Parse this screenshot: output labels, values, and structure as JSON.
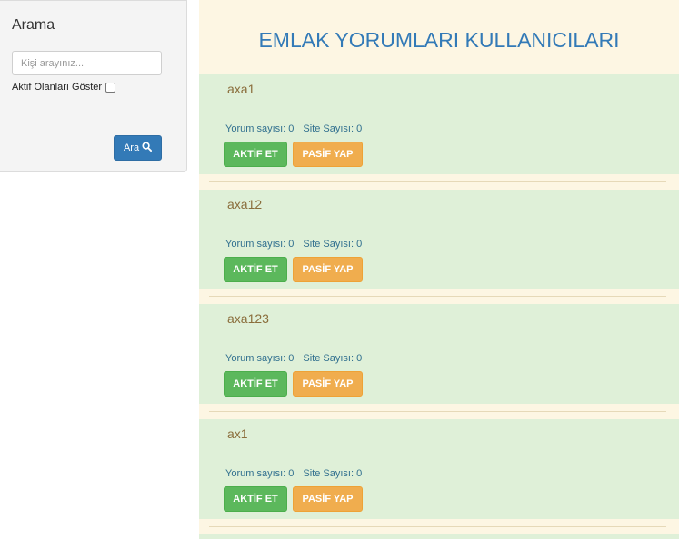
{
  "sidebar": {
    "title": "Arama",
    "search_placeholder": "Kişi arayınız...",
    "active_label": "Aktif Olanları Göster",
    "search_button": "Ara"
  },
  "main": {
    "title": "EMLAK YORUMLARI KULLANICILARI",
    "users": [
      {
        "name": "axa1",
        "comment_label": "Yorum sayısı: 0",
        "site_label": "Site Sayısı: 0",
        "activate": "AKTİF ET",
        "deactivate": "PASİF YAP"
      },
      {
        "name": "axa12",
        "comment_label": "Yorum sayısı: 0",
        "site_label": "Site Sayısı: 0",
        "activate": "AKTİF ET",
        "deactivate": "PASİF YAP"
      },
      {
        "name": "axa123",
        "comment_label": "Yorum sayısı: 0",
        "site_label": "Site Sayısı: 0",
        "activate": "AKTİF ET",
        "deactivate": "PASİF YAP"
      },
      {
        "name": "ax1",
        "comment_label": "Yorum sayısı: 0",
        "site_label": "Site Sayısı: 0",
        "activate": "AKTİF ET",
        "deactivate": "PASİF YAP"
      }
    ]
  },
  "colors": {
    "primary": "#337ab7",
    "success": "#5cb85c",
    "warning": "#f0ad4e",
    "card_bg": "#dff0d8",
    "main_bg": "#fdf6e3"
  }
}
